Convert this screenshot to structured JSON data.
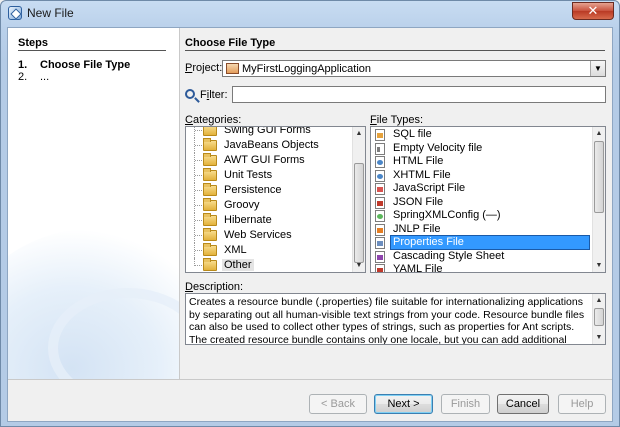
{
  "window": {
    "title": "New File",
    "close_glyph": "✕"
  },
  "steps": {
    "title": "Steps",
    "items": [
      {
        "num": "1.",
        "label": "Choose File Type"
      },
      {
        "num": "2.",
        "label": "..."
      }
    ]
  },
  "main": {
    "title": "Choose File Type",
    "project": {
      "label_u": "P",
      "label_rest": "roject:",
      "value": "MyFirstLoggingApplication"
    },
    "filter": {
      "label_pre": "F",
      "label_u": "i",
      "label_rest": "lter:",
      "value": ""
    },
    "categories": {
      "label_u": "C",
      "label_rest": "ategories:",
      "items": [
        "Swing GUI Forms",
        "JavaBeans Objects",
        "AWT GUI Forms",
        "Unit Tests",
        "Persistence",
        "Groovy",
        "Hibernate",
        "Web Services",
        "XML",
        "Other"
      ],
      "selected": "Other"
    },
    "file_types": {
      "label_u": "F",
      "label_rest": "ile Types:",
      "items": [
        {
          "label": "SQL file",
          "icon": "sql-file-icon"
        },
        {
          "label": "Empty Velocity file",
          "icon": "velocity-file-icon"
        },
        {
          "label": "HTML File",
          "icon": "html-file-icon"
        },
        {
          "label": "XHTML File",
          "icon": "xhtml-file-icon"
        },
        {
          "label": "JavaScript File",
          "icon": "javascript-file-icon"
        },
        {
          "label": "JSON File",
          "icon": "json-file-icon"
        },
        {
          "label": "SpringXMLConfig (—)",
          "icon": "spring-xml-icon"
        },
        {
          "label": "JNLP File",
          "icon": "jnlp-file-icon"
        },
        {
          "label": "Properties File",
          "icon": "properties-file-icon"
        },
        {
          "label": "Cascading Style Sheet",
          "icon": "css-file-icon"
        },
        {
          "label": "YAML File",
          "icon": "yaml-file-icon"
        }
      ],
      "selected": "Properties File"
    },
    "description": {
      "label_u": "D",
      "label_rest": "escription:",
      "text": "Creates a resource bundle (.properties) file suitable for internationalizing applications by separating out all human-visible text strings from your code. Resource bundle files can also be used to collect other types of strings, such as properties for Ant scripts. The created resource bundle contains only one locale, but you can add additional locales from the created file's"
    }
  },
  "buttons": {
    "back": "< Back",
    "back_u": "B",
    "next": "Next >",
    "next_u": "N",
    "finish": "Finish",
    "finish_u": "F",
    "cancel": "Cancel",
    "help": "Help",
    "help_u": "H"
  },
  "colors": {
    "selection": "#3399ff",
    "title_bar": "#b9d0ea",
    "close_button": "#c8513c"
  }
}
